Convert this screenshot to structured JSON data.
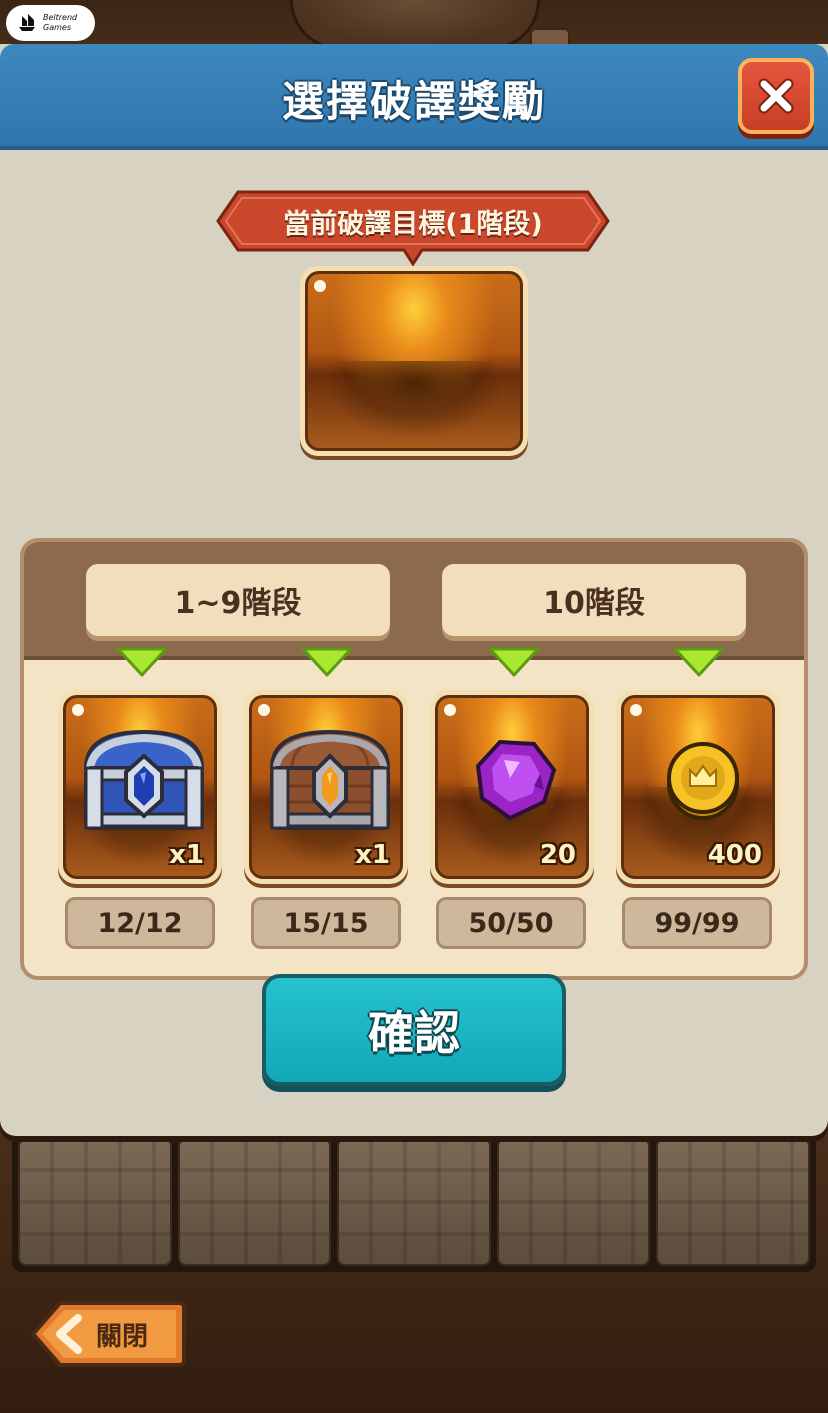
{
  "logo": {
    "line1": "Beltrend",
    "line2": "Games"
  },
  "dialog": {
    "title": "選擇破譯獎勵",
    "close_icon": "close-x-icon"
  },
  "target": {
    "label": "當前破譯目標(1階段)"
  },
  "tiers": [
    {
      "label": "1~9階段"
    },
    {
      "label": "10階段"
    }
  ],
  "rewards": [
    {
      "item": "sapphire-chest-icon",
      "quantity": "x1",
      "count": "12/12"
    },
    {
      "item": "wooden-chest-icon",
      "quantity": "x1",
      "count": "15/15"
    },
    {
      "item": "purple-gem-icon",
      "quantity": "20",
      "count": "50/50"
    },
    {
      "item": "gold-coin-icon",
      "quantity": "400",
      "count": "99/99"
    }
  ],
  "confirm_label": "確認",
  "back_label": "關閉",
  "colors": {
    "header_blue": "#3d88bf",
    "close_red": "#d94a30",
    "confirm_teal": "#1db6c4",
    "ribbon_red": "#c9472b",
    "marker_green": "#a8e830"
  }
}
